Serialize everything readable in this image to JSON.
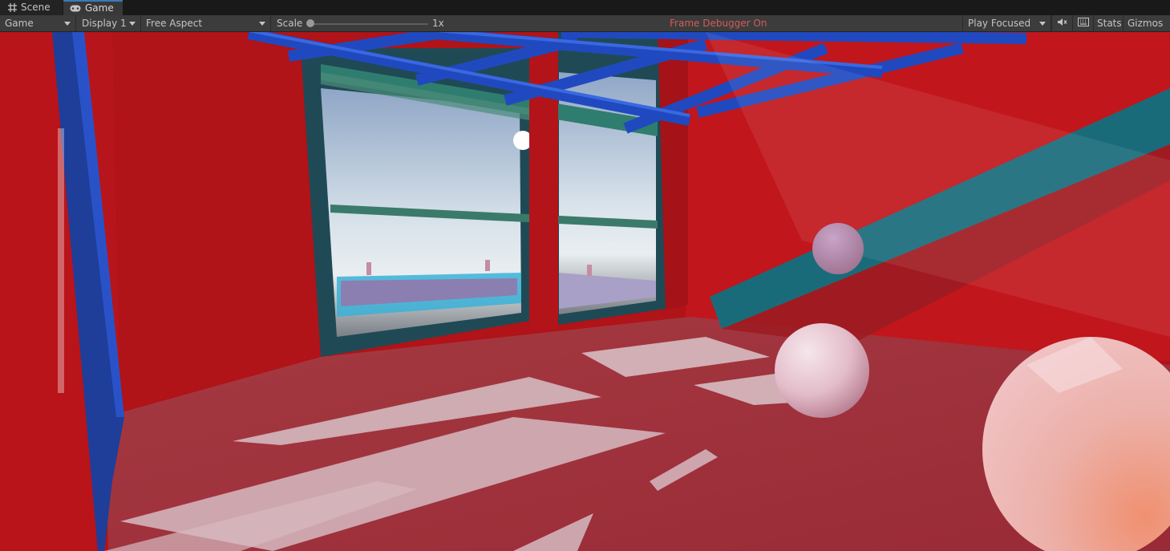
{
  "tabs": [
    {
      "label": "Scene",
      "icon": "scene-grid-icon",
      "active": false
    },
    {
      "label": "Game",
      "icon": "gamepad-icon",
      "active": true
    }
  ],
  "toolbar": {
    "view_mode": "Game",
    "display": "Display 1",
    "aspect": "Free Aspect",
    "scale_label": "Scale",
    "scale_value": "1x",
    "status": "Frame Debugger On",
    "play_mode": "Play Focused",
    "mute_icon": "audio-mute-icon",
    "resolution_icon": "keyboard-icon",
    "stats_label": "Stats",
    "gizmos_label": "Gizmos"
  },
  "colors": {
    "accent": "#3a79bb",
    "status_text": "#d65a5a",
    "wall_red": "#b0151a",
    "floor_red": "#a3323b",
    "truss_blue": "#1f46b8",
    "window_frame": "#1f4a55"
  }
}
